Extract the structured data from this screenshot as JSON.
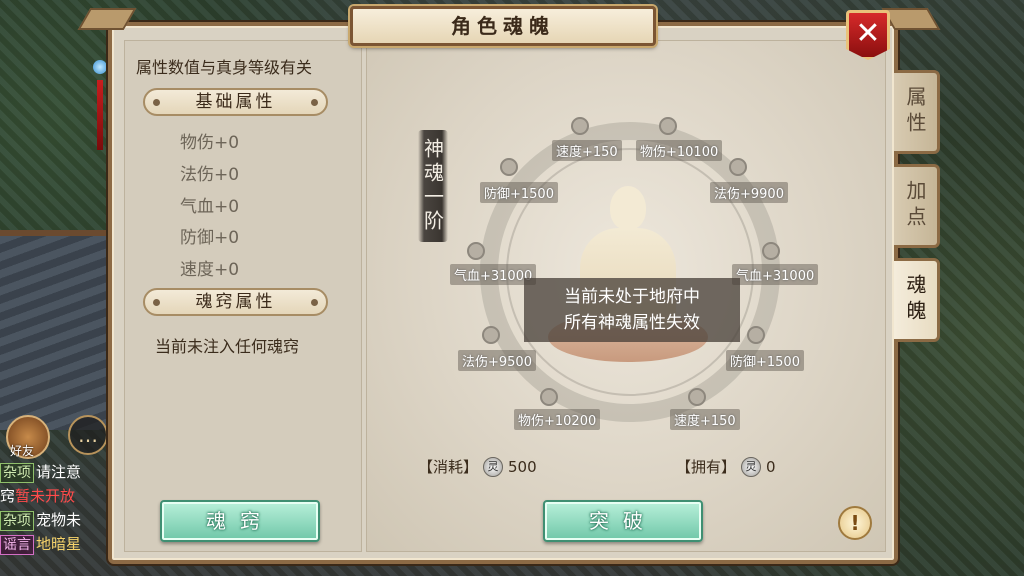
{
  "window": {
    "title": "角色魂魄",
    "close_label": "✕"
  },
  "tabs": [
    {
      "label": "属性",
      "active": false
    },
    {
      "label": "加点",
      "active": false
    },
    {
      "label": "魂魄",
      "active": true
    }
  ],
  "left": {
    "note": "属性数值与真身等级有关",
    "base_header": "基础属性",
    "base_attrs": [
      "物伤+0",
      "法伤+0",
      "气血+0",
      "防御+0",
      "速度+0"
    ],
    "soul_header": "魂窍属性",
    "soul_empty": "当前未注入任何魂窍",
    "soul_button": "魂窍"
  },
  "right": {
    "stage": "神魂一阶",
    "stats": {
      "speed_top": "速度+150",
      "phys_top": "物伤+10100",
      "def_tl": "防御+1500",
      "magic_tr": "法伤+9900",
      "hp_l": "气血+31000",
      "hp_r": "气血+31000",
      "magic_bl": "法伤+9500",
      "def_br": "防御+1500",
      "phys_bottom": "物伤+10200",
      "speed_bottom": "速度+150"
    },
    "notice_line1": "当前未处于地府中",
    "notice_line2": "所有神魂属性失效",
    "cost_label": "【消耗】",
    "cost_value": "500",
    "own_label": "【拥有】",
    "own_value": "0",
    "breakthrough_button": "突破",
    "warn_icon": "!"
  },
  "chat": {
    "friend_label": "好友",
    "lines": [
      {
        "tag": "杂项",
        "text": "请注意",
        "tag_style": "green"
      },
      {
        "tag": "",
        "text": "窍",
        "extra": "暂未开放"
      },
      {
        "tag": "杂项",
        "text": "宠物未",
        "tag_style": "green"
      },
      {
        "tag": "谣言",
        "text": "地暗星",
        "tag_style": "pink"
      }
    ]
  },
  "colors": {
    "panel_border": "#8c6a45",
    "close_red": "#d62a2a",
    "button_green": "#6fc7a8"
  }
}
